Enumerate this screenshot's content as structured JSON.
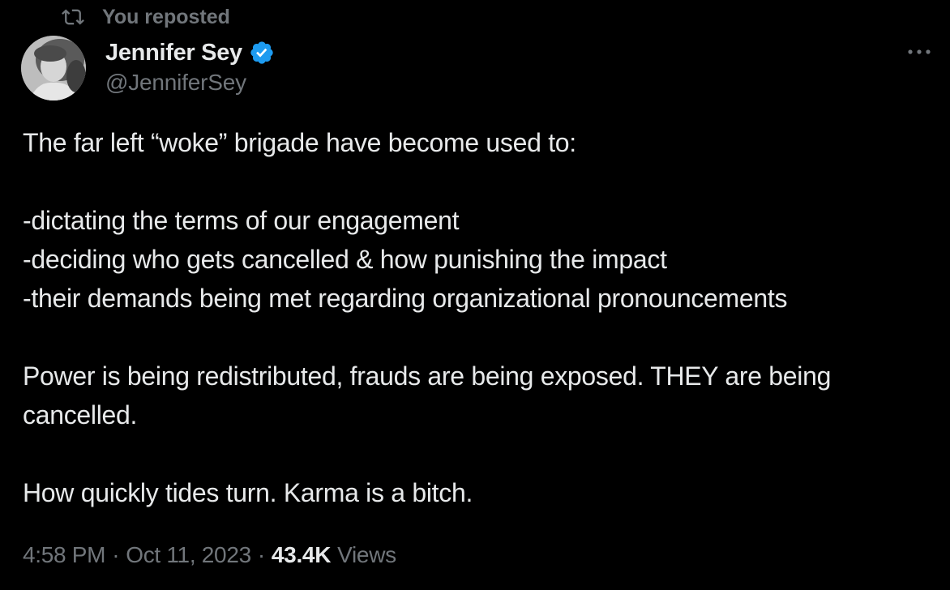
{
  "repost": {
    "icon": "repost-icon",
    "label": "You reposted"
  },
  "author": {
    "display_name": "Jennifer Sey",
    "handle": "@JenniferSey",
    "verified_icon": "verified-badge-icon",
    "verified_color": "#1d9bf0",
    "avatar_icon": "avatar-photo"
  },
  "more_icon": "more-options-icon",
  "body": {
    "line1": "The far left “woke” brigade have become used to:",
    "line2": "-dictating the terms of our engagement",
    "line3": "-deciding who gets cancelled & how punishing the impact",
    "line4": "-their demands being met regarding organizational pronouncements",
    "line5": "Power is being redistributed, frauds are being exposed. THEY are being cancelled.",
    "line6": "How quickly tides turn. Karma is a bitch."
  },
  "meta": {
    "time": "4:58 PM",
    "separator": "·",
    "date": "Oct 11, 2023",
    "views_count": "43.4K",
    "views_label": "Views"
  },
  "colors": {
    "background": "#000000",
    "primary_text": "#e7e9ea",
    "secondary_text": "#71767b",
    "accent": "#1d9bf0"
  }
}
